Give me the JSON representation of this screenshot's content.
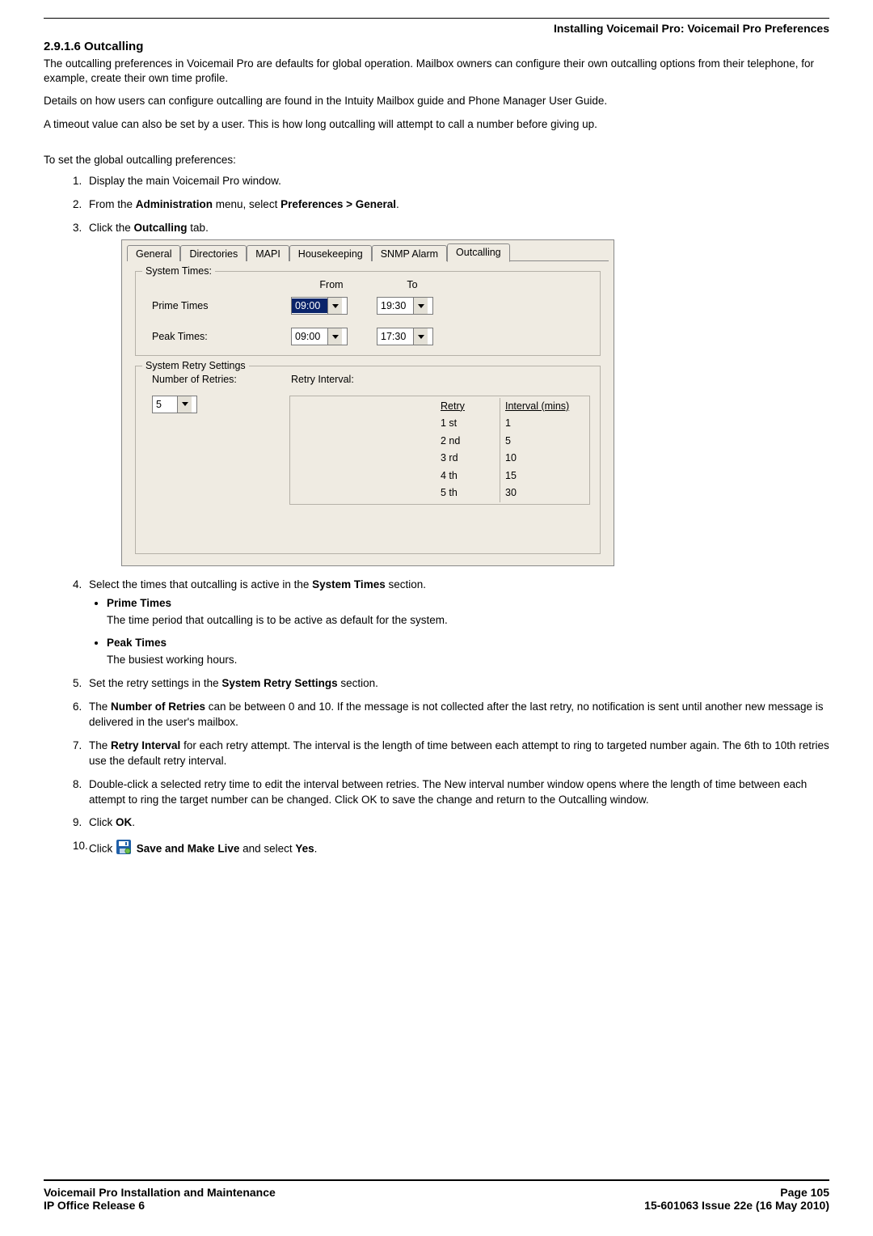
{
  "header": {
    "breadcrumb": "Installing Voicemail Pro: Voicemail Pro Preferences"
  },
  "section": {
    "number_title": "2.9.1.6 Outcalling",
    "p1": "The outcalling preferences in Voicemail Pro are defaults for global operation. Mailbox owners can configure their own outcalling options from their telephone, for example, create their own time profile.",
    "p2": "Details on how users can configure outcalling are found in the Intuity Mailbox guide and Phone Manager User Guide.",
    "p3": "A timeout value can also be set by a user. This is how long outcalling will attempt to call a number before giving up.",
    "sub_heading": "To set the global outcalling preferences:"
  },
  "steps": {
    "s1": "Display the main Voicemail Pro window.",
    "s2_a": "From the ",
    "s2_b": "Administration",
    "s2_c": " menu, select ",
    "s2_d": "Preferences > General",
    "s2_e": ".",
    "s3_a": "Click the ",
    "s3_b": "Outcalling",
    "s3_c": " tab.",
    "s4_a": "Select the times that outcalling is active in the ",
    "s4_b": "System Times",
    "s4_c": " section.",
    "s4_prime_h": "Prime Times",
    "s4_prime_t": "The time period that outcalling is to be active as default for the system.",
    "s4_peak_h": "Peak Times",
    "s4_peak_t": "The busiest working hours.",
    "s5_a": "Set the retry settings in the ",
    "s5_b": "System Retry Settings",
    "s5_c": " section.",
    "s6_a": "The ",
    "s6_b": "Number of Retries",
    "s6_c": " can be between 0 and 10. If the message is not collected after the last retry, no notification is sent until another new message is delivered in the user's mailbox.",
    "s7_a": "The ",
    "s7_b": "Retry Interval",
    "s7_c": " for each retry attempt. The interval is the length of time between each attempt to ring to targeted number again. The 6th to 10th retries use the default retry interval.",
    "s8": "Double-click a selected retry time to edit the interval between retries. The New interval number window opens where the length of time between each attempt to ring the target number can be changed. Click OK to save the change and return to the Outcalling window.",
    "s9_a": "Click ",
    "s9_b": "OK",
    "s9_c": ".",
    "s10_a": "Click ",
    "s10_b": " Save and Make Live",
    "s10_c": " and select ",
    "s10_d": "Yes",
    "s10_e": "."
  },
  "dialog": {
    "tabs": [
      "General",
      "Directories",
      "MAPI",
      "Housekeeping",
      "SNMP Alarm",
      "Outcalling"
    ],
    "system_times_legend": "System Times:",
    "from": "From",
    "to": "To",
    "prime_label": "Prime Times",
    "prime_from": "09:00",
    "prime_to": "19:30",
    "peak_label": "Peak Times:",
    "peak_from": "09:00",
    "peak_to": "17:30",
    "retry_legend": "System Retry Settings",
    "num_retries_label": "Number of Retries:",
    "num_retries_val": "5",
    "retry_interval_label": "Retry Interval:",
    "retry_hdr_1": "Retry",
    "retry_hdr_2": "Interval (mins)",
    "retry_rows": [
      {
        "r": "1 st",
        "i": "1"
      },
      {
        "r": "2 nd",
        "i": "5"
      },
      {
        "r": "3 rd",
        "i": "10"
      },
      {
        "r": "4 th",
        "i": "15"
      },
      {
        "r": "5 th",
        "i": "30"
      }
    ]
  },
  "footer": {
    "l1": "Voicemail Pro Installation and Maintenance",
    "l2": "IP Office Release 6",
    "r1": "Page 105",
    "r2": "15-601063 Issue 22e (16 May 2010)"
  }
}
